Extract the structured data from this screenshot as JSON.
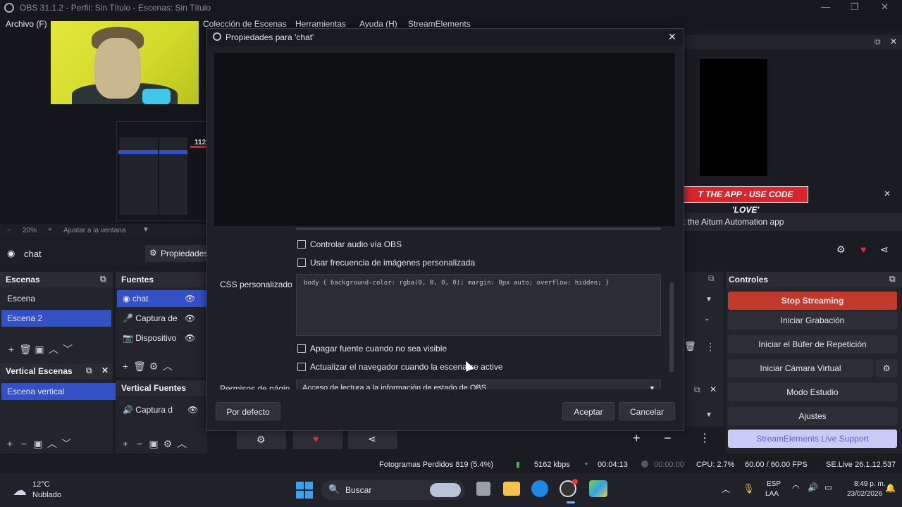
{
  "window": {
    "title": "OBS 31.1.2 - Perfil: Sin Título - Escenas: Sin Título",
    "controls": [
      "—",
      "❐",
      "✕"
    ]
  },
  "menu": [
    "Archivo (F)",
    "Colección de Escenas",
    "Herramientas",
    "Ayuda (H)",
    "StreamElements"
  ],
  "preview": {
    "zoom": "20%",
    "fit_label": "Ajustar a la ventana",
    "source_name": "chat",
    "properties_label": "Propiedades",
    "side_number": "112"
  },
  "scenes": {
    "header": "Escenas",
    "items": [
      {
        "label": "Escena",
        "selected": false
      },
      {
        "label": "Escena 2",
        "selected": true
      }
    ]
  },
  "sources": {
    "header": "Fuentes",
    "items": [
      {
        "label": "chat",
        "selected": true
      },
      {
        "label": "Captura de",
        "selected": false
      },
      {
        "label": "Dispositivo",
        "selected": false
      }
    ]
  },
  "vertical_scenes": {
    "header": "Vertical Escenas",
    "items": [
      {
        "label": "Escena vertical",
        "selected": true
      }
    ]
  },
  "vertical_sources": {
    "header": "Vertical Fuentes",
    "items": [
      {
        "label": "Captura d",
        "selected": false
      }
    ]
  },
  "dialog": {
    "title": "Propiedades para 'chat'",
    "checks": {
      "control_audio": "Controlar audio vía OBS",
      "custom_fps": "Usar frecuencia de imágenes personalizada",
      "shutdown_hidden": "Apagar fuente cuando no sea visible",
      "refresh_active": "Actualizar el navegador cuando la escena se active"
    },
    "css_label": "CSS personalizado",
    "css_value": "body { background-color: rgba(0, 0, 0, 0); margin: 0px auto; overflow: hidden; }",
    "permissions_label": "Permisos de págin",
    "permissions_value": "Acceso de lectura a la información de estado de OBS",
    "defaults_button": "Por defecto",
    "ok_button": "Aceptar",
    "cancel_button": "Cancelar"
  },
  "right_panel": {
    "banner": "T THE APP - USE CODE 'LOVE'",
    "info": "t the Aitum Automation app"
  },
  "controls": {
    "header": "Controles",
    "buttons": [
      "Stop Streaming",
      "Iniciar Grabación",
      "Iniciar el Búfer de Repetición",
      "Iniciar Cámara Virtual",
      "Modo Estudio",
      "Ajustes",
      "StreamElements Live Support"
    ]
  },
  "status": {
    "dropped": "Fotogramas Perdidos 819 (5.4%)",
    "bitrate": "5162 kbps",
    "stream_time": "00:04:13",
    "rec_time": "00:00:00",
    "cpu": "CPU: 2.7%",
    "fps": "60.00 / 60.00 FPS",
    "se_version": "SE.Live 26.1.12.537"
  },
  "taskbar": {
    "weather_temp": "12°C",
    "weather_desc": "Nublado",
    "search": "Buscar",
    "lang": "ESP",
    "region": "LAA",
    "time": "8:49 p. m.",
    "date": "23/02/2026"
  },
  "colors": {
    "accent": "#3450c5",
    "stop_streaming": "#c0392b",
    "banner": "#d7262e"
  }
}
